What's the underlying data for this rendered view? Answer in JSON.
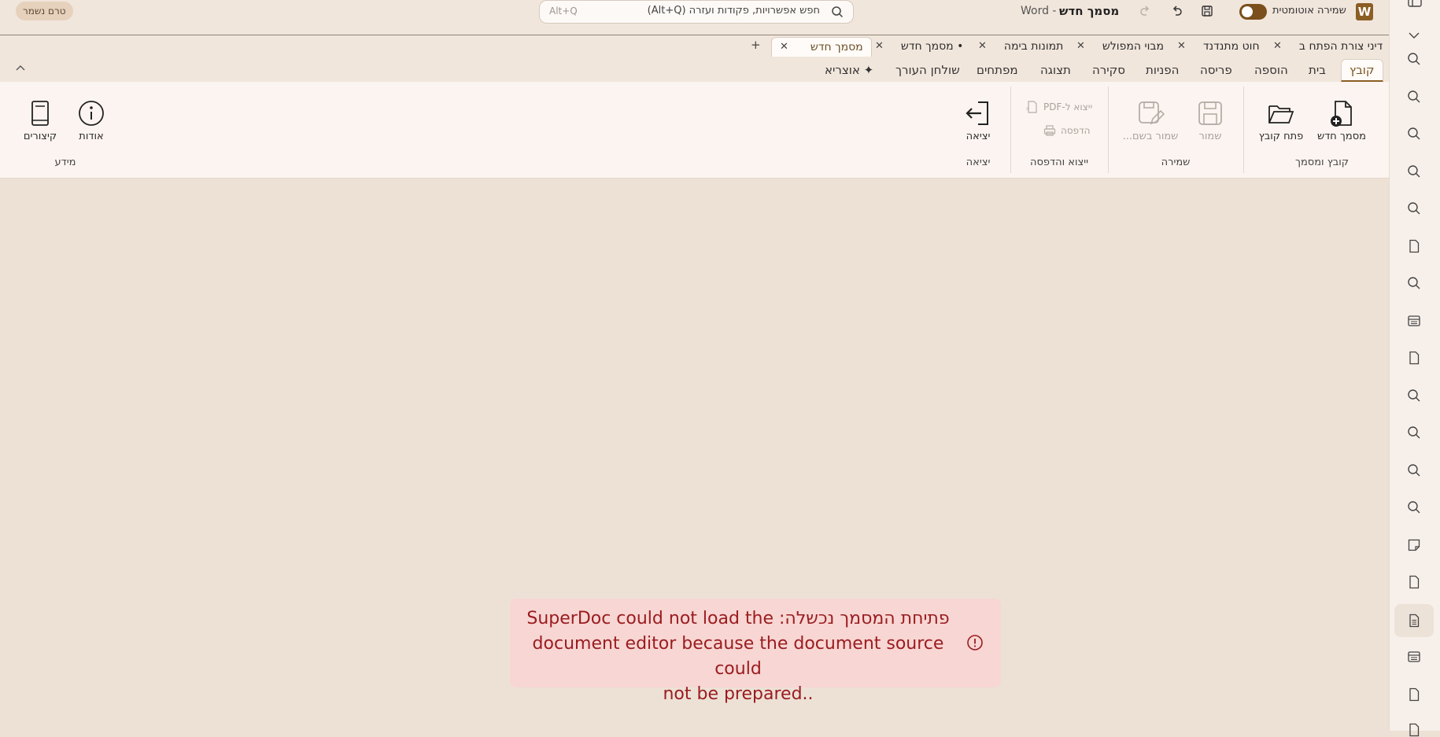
{
  "titlebar": {
    "unsaved_badge": "טרם נשמר",
    "search_placeholder": "חפש אפשרויות, פקודות ועזרה (Alt+Q)",
    "search_shortcut": "Alt+Q",
    "autosave_label": "שמירה אוטומטית",
    "doc_title": "מסמך חדש",
    "app_name": "Word -",
    "app_logo": "W"
  },
  "doc_tabs": [
    {
      "label": "דיני צורת הפתח ב"
    },
    {
      "label": "חוט מתנדנד"
    },
    {
      "label": "מבוי המפולש"
    },
    {
      "label": "תמונות בימה"
    },
    {
      "label": "• מסמך חדש"
    },
    {
      "label": "מסמך חדש"
    }
  ],
  "add_tab": "+",
  "ribbon_tabs": [
    "קובץ",
    "בית",
    "הוספה",
    "פריסה",
    "הפניות",
    "סקירה",
    "תצוגה",
    "מפתחים",
    "שולחן העורך",
    "✦ אוצריא"
  ],
  "ribbon": {
    "new_doc": "מסמך חדש",
    "open_file": "פתח קובץ",
    "group_file": "קובץ ומסמך",
    "save": "שמור",
    "save_as": "שמור בשם...",
    "group_save": "שמירה",
    "export_pdf": "ייצוא ל-PDF",
    "print": "הדפסה",
    "group_export": "ייצוא והדפסה",
    "exit": "יציאה",
    "group_exit": "יציאה",
    "about": "אודות",
    "shortcuts": "קיצורים",
    "group_info": "מידע"
  },
  "error": {
    "line1": "פתיחת המסמך נכשלה: SuperDoc could not load the",
    "line2": "document editor because the document source could",
    "line3": "..not be prepared"
  },
  "colors": {
    "accent": "#8b5e24",
    "error_bg": "#f7d6d3",
    "error_text": "#9b1c20"
  }
}
